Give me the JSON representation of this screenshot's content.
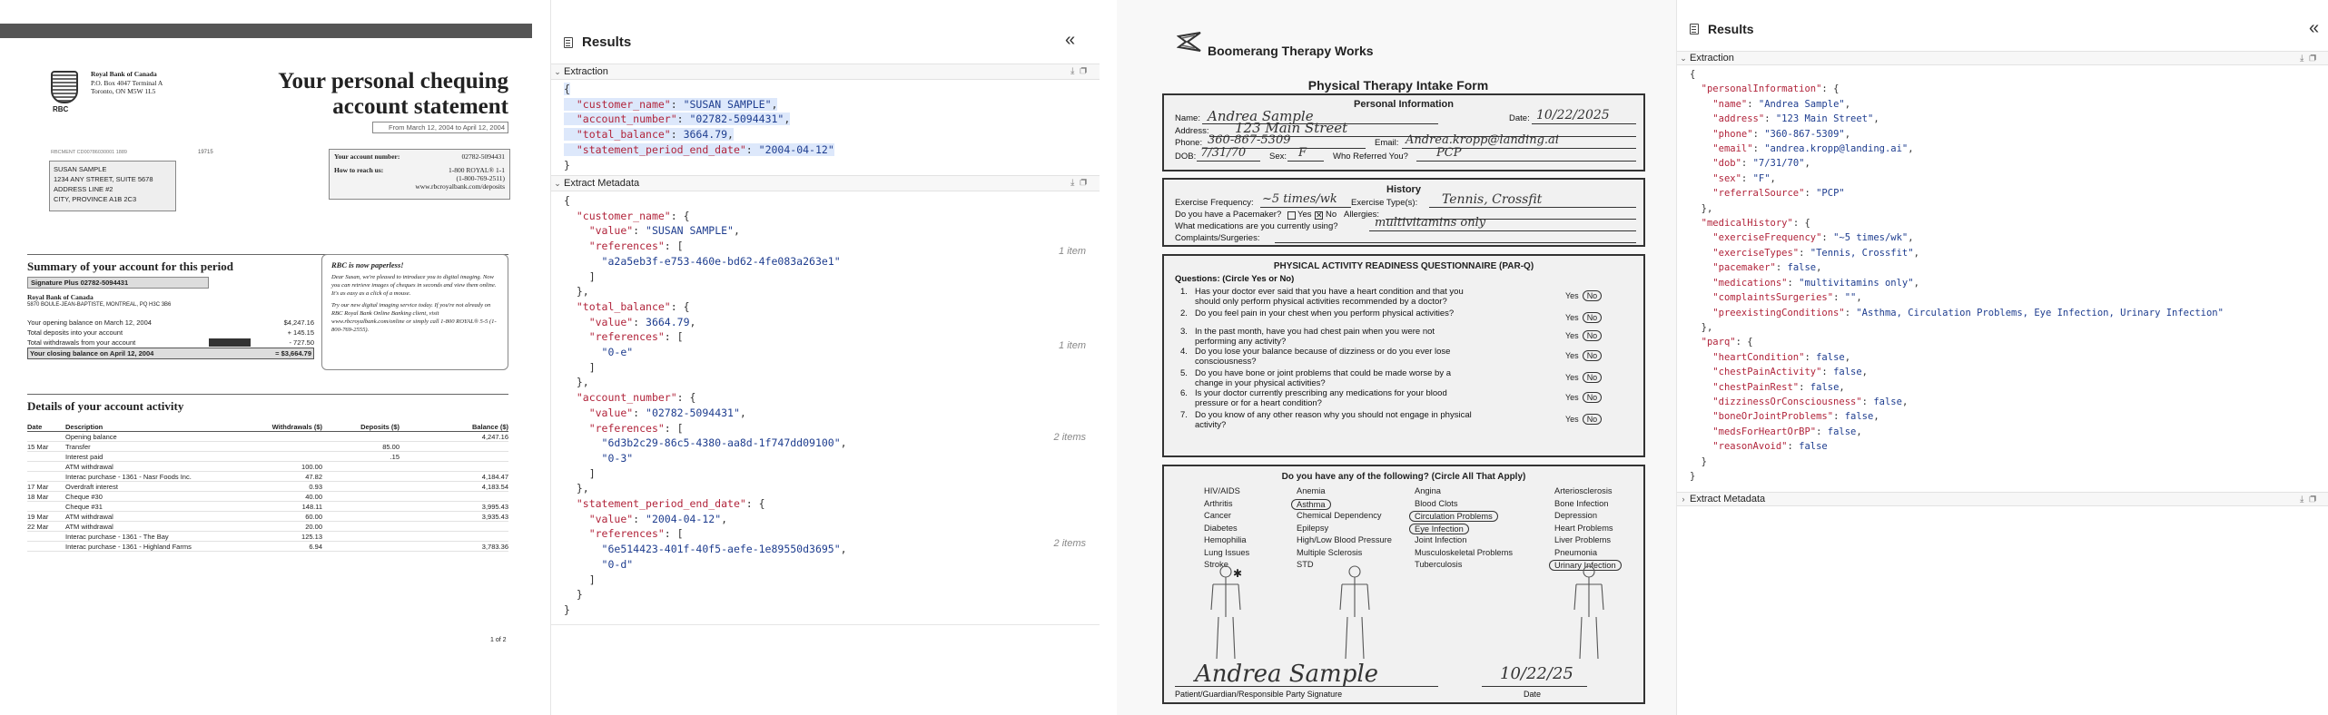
{
  "statement": {
    "bank_name": "Royal Bank of Canada",
    "bank_addr1": "P.O. Box 4047 Terminal A",
    "bank_addr2": "Toronto, ON M5W 1L5",
    "logo_text": "RBC",
    "title_line1": "Your personal chequing",
    "title_line2": "account statement",
    "period": "From March 12, 2004 to April 12, 2004",
    "ref_code": "RBCMENT CD00786030001 1889",
    "ref_num": "19715",
    "addr": [
      "SUSAN SAMPLE",
      "1234 ANY STREET, SUITE 5678",
      "ADDRESS LINE #2",
      "CITY, PROVINCE  A1B 2C3"
    ],
    "acct_label": "Your account number:",
    "acct_value": "02782-5094431",
    "reach_label": "How to reach us:",
    "reach_1": "1-800 ROYAL® 1-1",
    "reach_2": "(1-800-769-2511)",
    "reach_3": "www.rbcroyalbank.com/deposits",
    "summary_title": "Summary of your account for this period",
    "plan": "Signature Plus 02782-5094431",
    "branch_name": "Royal Bank of Canada",
    "branch_addr": "5870 BOULE-JEAN-BAPTISTE, MONTREAL, PQ  H3C 3B6",
    "summary_rows": [
      {
        "label": "Your opening balance on March 12, 2004",
        "value": "$4,247.16"
      },
      {
        "label": "Total deposits into your account",
        "value": "+ 145.15"
      },
      {
        "label": "Total withdrawals from your account",
        "value": "- 727.50"
      },
      {
        "label": "Your closing balance on April 12, 2004",
        "value": "= $3,664.79"
      }
    ],
    "paperless_title": "RBC is now paperless!",
    "paperless_p1": "Dear Susan, we're pleased to introduce you to digital imaging. Now you can retrieve images of cheques in seconds and view them online. It's as easy as a click of a mouse.",
    "paperless_p2": "Try our new digital imaging service today. If you're not already on RBC Royal Bank Online Banking client, visit www.rbcroyalbank.com/online or simply call 1-800 ROYAL® 5-5 (1-800-769-2555).",
    "details_title": "Details of your account activity",
    "col_date": "Date",
    "col_desc": "Description",
    "col_wd": "Withdrawals ($)",
    "col_dep": "Deposits ($)",
    "col_bal": "Balance ($)",
    "rows": [
      {
        "date": "",
        "desc": "Opening balance",
        "wd": "",
        "dep": "",
        "bal": "4,247.16"
      },
      {
        "date": "15 Mar",
        "desc": "Transfer",
        "wd": "",
        "dep": "85.00",
        "bal": ""
      },
      {
        "date": "",
        "desc": "Interest paid",
        "wd": "",
        "dep": ".15",
        "bal": ""
      },
      {
        "date": "",
        "desc": "ATM withdrawal",
        "wd": "100.00",
        "dep": "",
        "bal": ""
      },
      {
        "date": "",
        "desc": "Interac purchase - 1361 - Nasr Foods Inc.",
        "wd": "47.82",
        "dep": "",
        "bal": "4,184.47"
      },
      {
        "date": "17 Mar",
        "desc": "Overdraft interest",
        "wd": "0.93",
        "dep": "",
        "bal": "4,183.54"
      },
      {
        "date": "18 Mar",
        "desc": "Cheque #30",
        "wd": "40.00",
        "dep": "",
        "bal": ""
      },
      {
        "date": "",
        "desc": "Cheque #31",
        "wd": "148.11",
        "dep": "",
        "bal": "3,995.43"
      },
      {
        "date": "19 Mar",
        "desc": "ATM withdrawal",
        "wd": "60.00",
        "dep": "",
        "bal": "3,935.43"
      },
      {
        "date": "22 Mar",
        "desc": "ATM withdrawal",
        "wd": "20.00",
        "dep": "",
        "bal": ""
      },
      {
        "date": "",
        "desc": "Interac purchase - 1361 - The Bay",
        "wd": "125.13",
        "dep": "",
        "bal": ""
      },
      {
        "date": "",
        "desc": "Interac purchase - 1361 - Highland Farms",
        "wd": "6.94",
        "dep": "",
        "bal": "3,783.36"
      }
    ],
    "page": "1 of 2"
  },
  "results1": {
    "title": "Results",
    "collapse": "«",
    "extraction_label": "Extraction",
    "metadata_label": "Extract Metadata",
    "extraction_lines": [
      "{",
      "  \"customer_name\": \"SUSAN SAMPLE\",",
      "  \"account_number\": \"02782-5094431\",",
      "  \"total_balance\": 3664.79,",
      "  \"statement_period_end_date\": \"2004-04-12\"",
      "}"
    ],
    "metadata_lines": [
      "{",
      "  \"customer_name\": {",
      "    \"value\": \"SUSAN SAMPLE\",",
      "    \"references\": [",
      "      \"a2a5eb3f-e753-460e-bd62-4fe083a263e1\"",
      "    ]",
      "  },",
      "  \"total_balance\": {",
      "    \"value\": 3664.79,",
      "    \"references\": [",
      "      \"0-e\"",
      "    ]",
      "  },",
      "  \"account_number\": {",
      "    \"value\": \"02782-5094431\",",
      "    \"references\": [",
      "      \"6d3b2c29-86c5-4380-aa8d-1f747dd09100\",",
      "      \"0-3\"",
      "    ]",
      "  },",
      "  \"statement_period_end_date\": {",
      "    \"value\": \"2004-04-12\",",
      "    \"references\": [",
      "      \"6e514423-401f-40f5-aefe-1e89550d3695\",",
      "      \"0-d\"",
      "    ]",
      "  }",
      "}"
    ],
    "counts": [
      "1 item",
      "1 item",
      "2 items",
      "2 items"
    ]
  },
  "form": {
    "company": "Boomerang Therapy Works",
    "title": "Physical Therapy Intake Form",
    "personal_title": "Personal Information",
    "name_label": "Name:",
    "name_val": "Andrea Sample",
    "date_label": "Date:",
    "date_val": "10/22/2025",
    "address_label": "Address:",
    "address_val": "123 Main Street",
    "phone_label": "Phone:",
    "phone_val": "360-867-5309",
    "email_label": "Email:",
    "email_val": "Andrea.kropp@landing.ai",
    "dob_label": "DOB:",
    "dob_val": "7/31/70",
    "sex_label": "Sex:",
    "sex_val": "F",
    "referred_label": "Who Referred You?",
    "referred_val": "PCP",
    "history_title": "History",
    "freq_label": "Exercise Frequency:",
    "freq_val": "~5 times/wk",
    "types_label": "Exercise Type(s):",
    "types_val": "Tennis, Crossfit",
    "pacemaker_label": "Do you have a Pacemaker?",
    "yes_label": "Yes",
    "no_label": "No",
    "allergies_label": "Allergies:",
    "meds_label": "What medications are you currently using?",
    "meds_val": "multivitamins only",
    "complaints_label": "Complaints/Surgeries:",
    "parq_title": "PHYSICAL ACTIVITY READINESS QUESTIONNAIRE (PAR-Q)",
    "parq_sub": "Questions: (Circle Yes or No)",
    "questions": [
      {
        "n": "1.",
        "l1": "Has your doctor ever said that you have a heart condition and that you",
        "l2": "should only perform physical activities recommended by a doctor?"
      },
      {
        "n": "2.",
        "l1": "Do you feel pain in your chest when you perform physical activities?",
        "l2": ""
      },
      {
        "n": "3.",
        "l1": "In the past month, have you had chest pain when you were not",
        "l2": "performing any activity?"
      },
      {
        "n": "4.",
        "l1": "Do you lose your balance because of dizziness or do you ever lose",
        "l2": "consciousness?"
      },
      {
        "n": "5.",
        "l1": "Do you have bone or joint problems that could be made worse by a",
        "l2": "change in your physical activities?"
      },
      {
        "n": "6.",
        "l1": "Is your doctor currently prescribing any medications for your blood",
        "l2": "pressure or for a heart condition?"
      },
      {
        "n": "7.",
        "l1": "Do you know of any other reason why you should not engage in physical",
        "l2": "activity?"
      }
    ],
    "cond_title": "Do you have any of the following? (Circle All That Apply)",
    "cond_cols": [
      [
        "HIV/AIDS",
        "Arthritis",
        "Cancer",
        "Diabetes",
        "Hemophilia",
        "Lung Issues",
        "Stroke"
      ],
      [
        "Anemia",
        "Asthma",
        "Chemical Dependency",
        "Epilepsy",
        "High/Low Blood Pressure",
        "Multiple Sclerosis",
        "STD"
      ],
      [
        "Angina",
        "Blood Clots",
        "Circulation Problems",
        "Eye Infection",
        "Joint Infection",
        "Musculoskeletal Problems",
        "Tuberculosis"
      ],
      [
        "Arteriosclerosis",
        "Bone Infection",
        "Depression",
        "Heart Problems",
        "Liver Problems",
        "Pneumonia",
        "Urinary Infection"
      ]
    ],
    "signature": "Andrea Sample",
    "sig_date": "10/22/25",
    "sig_label": "Patient/Guardian/Responsible Party Signature",
    "sig_date_label": "Date"
  },
  "results2": {
    "title": "Results",
    "collapse": "«",
    "extraction_label": "Extraction",
    "metadata_label": "Extract Metadata",
    "lines": [
      "{",
      "  \"personalInformation\": {",
      "    \"name\": \"Andrea Sample\",",
      "    \"address\": \"123 Main Street\",",
      "    \"phone\": \"360-867-5309\",",
      "    \"email\": \"andrea.kropp@landing.ai\",",
      "    \"dob\": \"7/31/70\",",
      "    \"sex\": \"F\",",
      "    \"referralSource\": \"PCP\"",
      "  },",
      "  \"medicalHistory\": {",
      "    \"exerciseFrequency\": \"~5 times/wk\",",
      "    \"exerciseTypes\": \"Tennis, Crossfit\",",
      "    \"pacemaker\": false,",
      "    \"medications\": \"multivitamins only\",",
      "    \"complaintsSurgeries\": \"\",",
      "    \"preexistingConditions\": \"Asthma, Circulation Problems, Eye Infection, Urinary Infection\"",
      "  },",
      "  \"parq\": {",
      "    \"heartCondition\": false,",
      "    \"chestPainActivity\": false,",
      "    \"chestPainRest\": false,",
      "    \"dizzinessOrConsciousness\": false,",
      "    \"boneOrJointProblems\": false,",
      "    \"medsForHeartOrBP\": false,",
      "    \"reasonAvoid\": false",
      "  }",
      "}"
    ]
  }
}
